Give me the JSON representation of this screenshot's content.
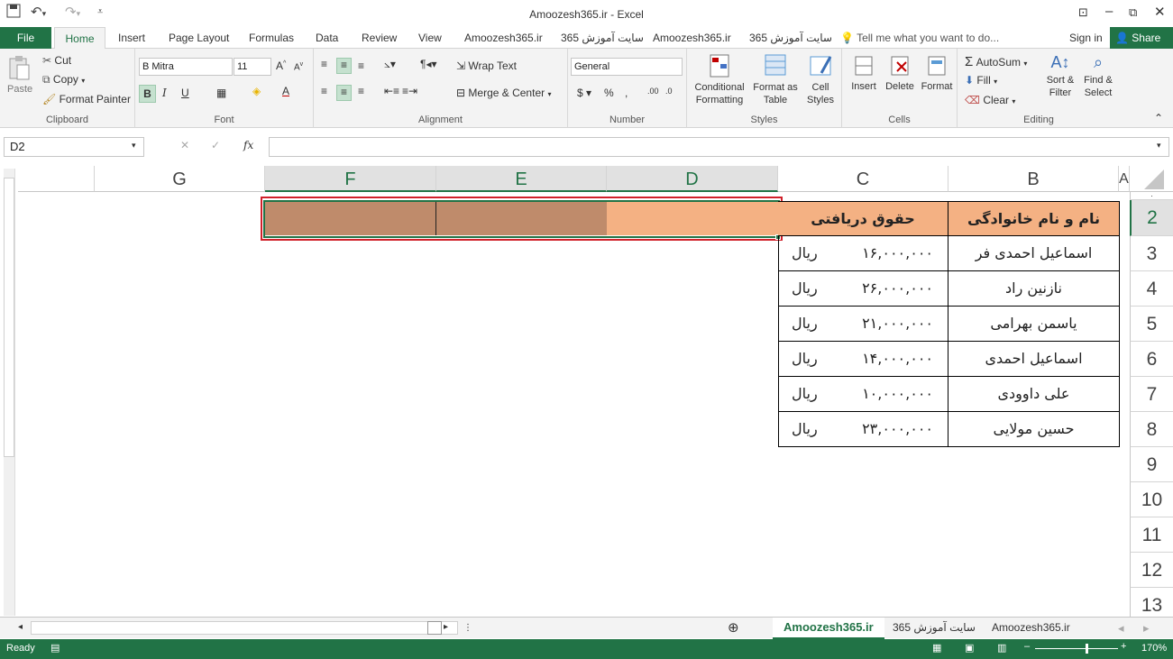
{
  "window": {
    "title": "Amoozesh365.ir - Excel"
  },
  "ribbon_tabs": [
    "File",
    "Home",
    "Insert",
    "Page Layout",
    "Formulas",
    "Data",
    "Review",
    "View",
    "Amoozesh365.ir",
    "سایت آموزش 365",
    "Amoozesh365.ir",
    "سایت آموزش 365"
  ],
  "tell_me": "Tell me what you want to do...",
  "sign_in": "Sign in",
  "share": "Share",
  "clipboard": {
    "paste": "Paste",
    "cut": "Cut",
    "copy": "Copy",
    "format_painter": "Format Painter",
    "label": "Clipboard"
  },
  "font": {
    "name": "B Mitra",
    "size": "11",
    "label": "Font"
  },
  "alignment": {
    "wrap_text": "Wrap Text",
    "merge_center": "Merge & Center",
    "label": "Alignment"
  },
  "number": {
    "format": "General",
    "label": "Number"
  },
  "styles": {
    "conditional": [
      "Conditional",
      "Formatting"
    ],
    "format_table": [
      "Format as",
      "Table"
    ],
    "cell_styles": [
      "Cell",
      "Styles"
    ],
    "label": "Styles"
  },
  "cells_grp": {
    "insert": "Insert",
    "delete": "Delete",
    "format": "Format",
    "label": "Cells"
  },
  "editing": {
    "autosum": "AutoSum",
    "fill": "Fill",
    "clear": "Clear",
    "sort": [
      "Sort &",
      "Filter"
    ],
    "find": [
      "Find &",
      "Select"
    ],
    "label": "Editing"
  },
  "name_box": "D2",
  "columns": [
    "G",
    "F",
    "E",
    "D",
    "C",
    "B",
    "A"
  ],
  "rows": [
    "2",
    "3",
    "4",
    "5",
    "6",
    "7",
    "8",
    "9",
    "10",
    "11",
    "12",
    "13"
  ],
  "table": {
    "header_name": "نام و نام خانوادگی",
    "header_salary": "حقوق دریافتی",
    "currency": "ریال",
    "rows": [
      {
        "name": "اسماعیل احمدی فر",
        "salary": "۱۶,۰۰۰,۰۰۰"
      },
      {
        "name": "نازنین راد",
        "salary": "۲۶,۰۰۰,۰۰۰"
      },
      {
        "name": "یاسمن بهرامی",
        "salary": "۲۱,۰۰۰,۰۰۰"
      },
      {
        "name": "اسماعیل احمدی",
        "salary": "۱۴,۰۰۰,۰۰۰"
      },
      {
        "name": "علی داوودی",
        "salary": "۱۰,۰۰۰,۰۰۰"
      },
      {
        "name": "حسین مولایی",
        "salary": "۲۳,۰۰۰,۰۰۰"
      }
    ]
  },
  "sheet_tabs": [
    "Amoozesh365.ir",
    "سایت آموزش 365",
    "Amoozesh365.ir"
  ],
  "status": {
    "ready": "Ready",
    "zoom": "170%"
  },
  "colors": {
    "excel_green": "#217346",
    "header_fill": "#f4b183",
    "selected_fill": "#bf8b6b"
  }
}
